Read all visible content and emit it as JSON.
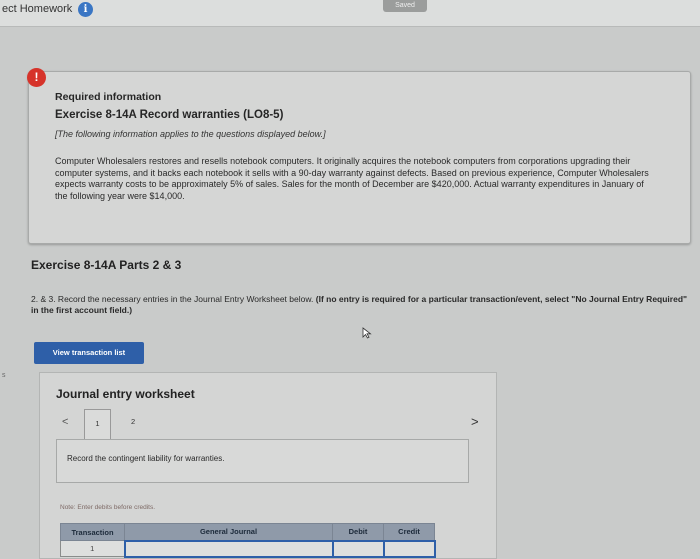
{
  "header": {
    "title": "ect Homework",
    "info_icon": "i",
    "saved_label": "Saved"
  },
  "alert": {
    "badge": "!",
    "heading": "Required information",
    "exercise_title": "Exercise 8-14A Record warranties (LO8-5)",
    "note": "[The following information applies to the questions displayed below.]",
    "description": "Computer Wholesalers restores and resells notebook computers. It originally acquires the notebook computers from corporations upgrading their computer systems, and it backs each notebook it sells with a 90-day warranty against defects. Based on previous experience, Computer Wholesalers expects warranty costs to be approximately 5% of sales. Sales for the month of December are $420,000. Actual warranty expenditures in January of the following year were $14,000."
  },
  "section": {
    "title": "Exercise 8-14A Parts 2 & 3",
    "instruction_plain": "2. & 3. Record the necessary entries in the Journal Entry Worksheet below.",
    "instruction_bold": "(If no entry is required for a particular transaction/event, select \"No Journal Entry Required\" in the first account field.)"
  },
  "view_button": "View transaction list",
  "side_marker": "s",
  "worksheet": {
    "title": "Journal entry worksheet",
    "prev": "<",
    "next": ">",
    "pages": [
      "1",
      "2"
    ],
    "task": "Record the contingent liability for warranties.",
    "note": "Note: Enter debits before credits.",
    "columns": [
      "Transaction",
      "General Journal",
      "Debit",
      "Credit"
    ],
    "rows": [
      {
        "transaction": "1",
        "account": "",
        "debit": "",
        "credit": ""
      }
    ]
  },
  "colors": {
    "alert_red": "#d6332a",
    "button_blue": "#2e5fa8",
    "table_header": "#8f9aa9"
  }
}
